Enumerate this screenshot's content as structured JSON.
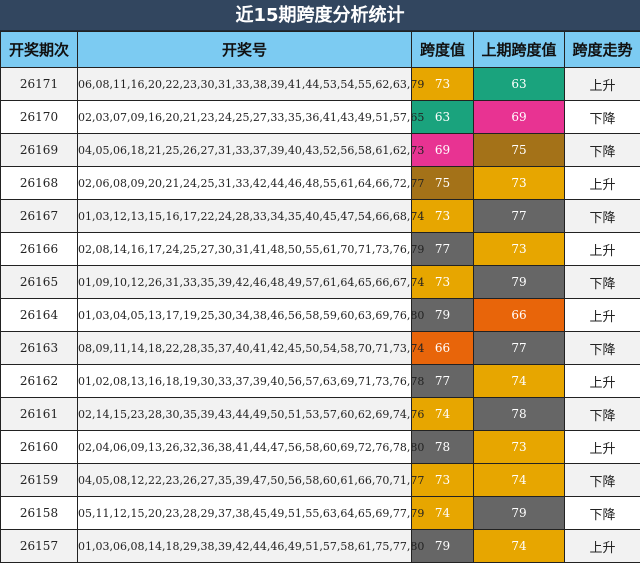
{
  "title": "近15期跨度分析统计",
  "headers": [
    "开奖期次",
    "开奖号",
    "跨度值",
    "上期跨度值",
    "跨度走势"
  ],
  "colors": {
    "63": "#1aa37d",
    "66": "#e8650a",
    "69": "#e83392",
    "73": "#e7a600",
    "74": "#e7a600",
    "75": "#a47218",
    "77": "#666666",
    "78": "#666666",
    "79": "#666666"
  },
  "rows": [
    {
      "issue": "26171",
      "numbers": "06,08,11,16,20,22,23,30,31,33,38,39,41,44,53,54,55,62,63,79",
      "span": "73",
      "prev": "63",
      "trend": "上升"
    },
    {
      "issue": "26170",
      "numbers": "02,03,07,09,16,20,21,23,24,25,27,33,35,36,41,43,49,51,57,65",
      "span": "63",
      "prev": "69",
      "trend": "下降"
    },
    {
      "issue": "26169",
      "numbers": "04,05,06,18,21,25,26,27,31,33,37,39,40,43,52,56,58,61,62,73",
      "span": "69",
      "prev": "75",
      "trend": "下降"
    },
    {
      "issue": "26168",
      "numbers": "02,06,08,09,20,21,24,25,31,33,42,44,46,48,55,61,64,66,72,77",
      "span": "75",
      "prev": "73",
      "trend": "上升"
    },
    {
      "issue": "26167",
      "numbers": "01,03,12,13,15,16,17,22,24,28,33,34,35,40,45,47,54,66,68,74",
      "span": "73",
      "prev": "77",
      "trend": "下降"
    },
    {
      "issue": "26166",
      "numbers": "02,08,14,16,17,24,25,27,30,31,41,48,50,55,61,70,71,73,76,79",
      "span": "77",
      "prev": "73",
      "trend": "上升"
    },
    {
      "issue": "26165",
      "numbers": "01,09,10,12,26,31,33,35,39,42,46,48,49,57,61,64,65,66,67,74",
      "span": "73",
      "prev": "79",
      "trend": "下降"
    },
    {
      "issue": "26164",
      "numbers": "01,03,04,05,13,17,19,25,30,34,38,46,56,58,59,60,63,69,76,80",
      "span": "79",
      "prev": "66",
      "trend": "上升"
    },
    {
      "issue": "26163",
      "numbers": "08,09,11,14,18,22,28,35,37,40,41,42,45,50,54,58,70,71,73,74",
      "span": "66",
      "prev": "77",
      "trend": "下降"
    },
    {
      "issue": "26162",
      "numbers": "01,02,08,13,16,18,19,30,33,37,39,40,56,57,63,69,71,73,76,78",
      "span": "77",
      "prev": "74",
      "trend": "上升"
    },
    {
      "issue": "26161",
      "numbers": "02,14,15,23,28,30,35,39,43,44,49,50,51,53,57,60,62,69,74,76",
      "span": "74",
      "prev": "78",
      "trend": "下降"
    },
    {
      "issue": "26160",
      "numbers": "02,04,06,09,13,26,32,36,38,41,44,47,56,58,60,69,72,76,78,80",
      "span": "78",
      "prev": "73",
      "trend": "上升"
    },
    {
      "issue": "26159",
      "numbers": "04,05,08,12,22,23,26,27,35,39,47,50,56,58,60,61,66,70,71,77",
      "span": "73",
      "prev": "74",
      "trend": "下降"
    },
    {
      "issue": "26158",
      "numbers": "05,11,12,15,20,23,28,29,37,38,45,49,51,55,63,64,65,69,77,79",
      "span": "74",
      "prev": "79",
      "trend": "下降"
    },
    {
      "issue": "26157",
      "numbers": "01,03,06,08,14,18,29,38,39,42,44,46,49,51,57,58,61,75,77,80",
      "span": "79",
      "prev": "74",
      "trend": "上升"
    }
  ]
}
